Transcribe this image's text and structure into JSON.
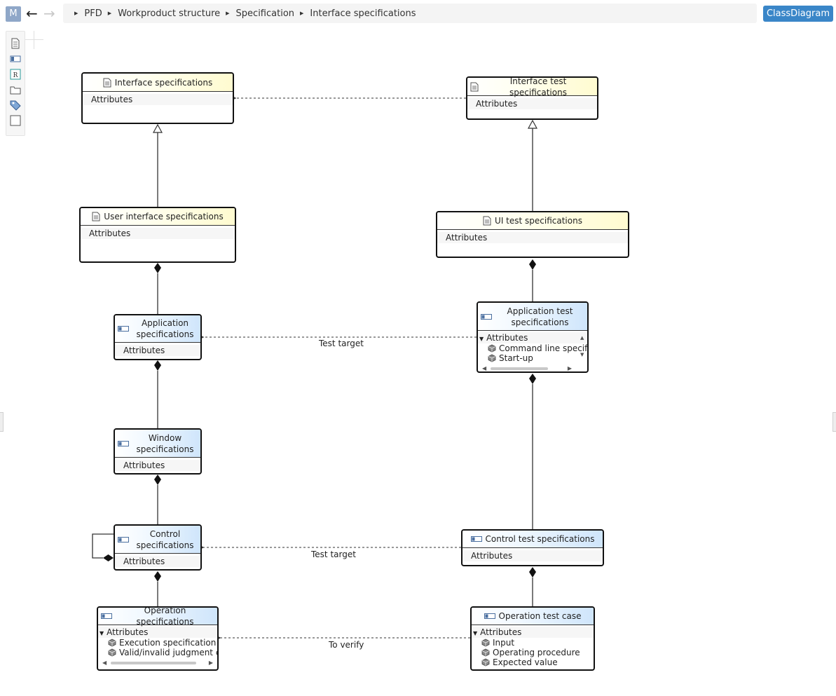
{
  "app": {
    "mode_button": "M",
    "view_button": "ClassDiagram"
  },
  "breadcrumb": [
    "PFD",
    "Workproduct structure",
    "Specification",
    "Interface specifications"
  ],
  "palette": [
    "document-icon",
    "block-icon",
    "requirement-icon",
    "folder-icon",
    "tag-icon",
    "rectangle-icon"
  ],
  "classes": {
    "interface_spec": {
      "title": "Interface specifications",
      "attributes": "Attributes"
    },
    "interface_test_spec": {
      "title": "Interface test specifications",
      "attributes": "Attributes"
    },
    "user_interface_spec": {
      "title": "User interface specifications",
      "attributes": "Attributes"
    },
    "ui_test_spec": {
      "title": "UI test specifications",
      "attributes": "Attributes"
    },
    "application_spec": {
      "title": "Application specifications",
      "attributes": "Attributes"
    },
    "application_test_spec": {
      "title": "Application test specifications",
      "attributes": "Attributes",
      "items": [
        "Command line specifi",
        "Start-up"
      ]
    },
    "window_spec": {
      "title": "Window specifications",
      "attributes": "Attributes"
    },
    "control_spec": {
      "title": "Control specifications",
      "attributes": "Attributes"
    },
    "control_test_spec": {
      "title": "Control test specifications",
      "attributes": "Attributes"
    },
    "operation_spec": {
      "title": "Operation specifications",
      "attributes": "Attributes",
      "items": [
        "Execution specification",
        "Valid/invalid judgment crite"
      ]
    },
    "operation_test_case": {
      "title": "Operation test case",
      "attributes": "Attributes",
      "items": [
        "Input",
        "Operating procedure",
        "Expected value"
      ]
    }
  },
  "link_labels": {
    "app_test_target": "Test target",
    "control_test_target": "Test target",
    "op_to_verify": "To verify"
  }
}
